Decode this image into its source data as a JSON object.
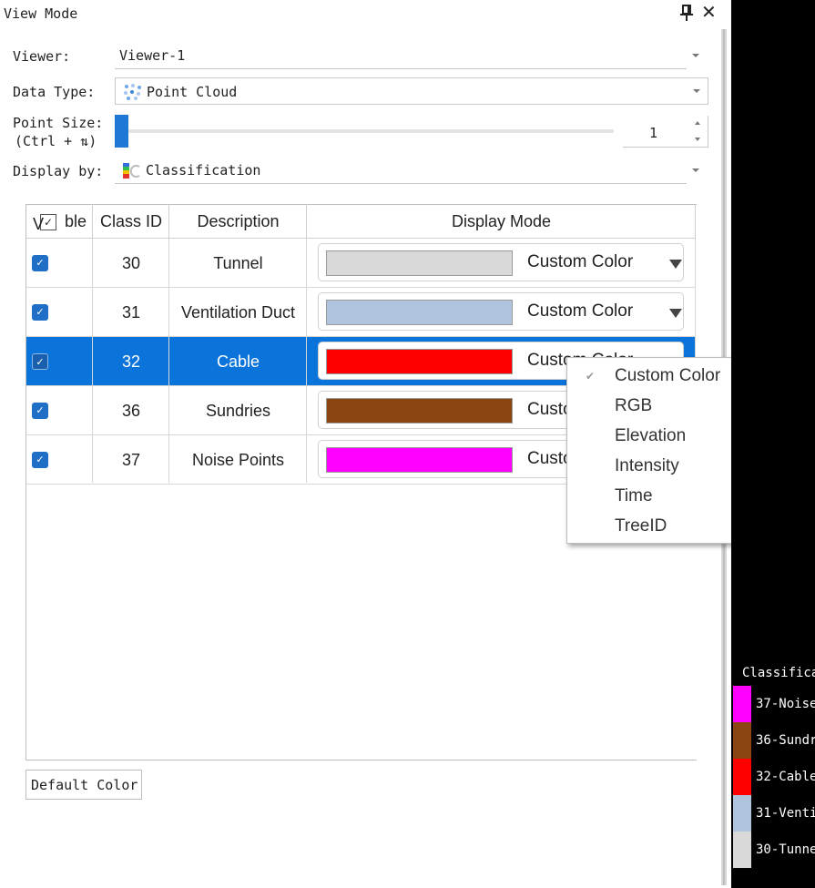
{
  "panel": {
    "title": "View Mode",
    "close_glyph": "✕"
  },
  "props": {
    "viewer_label": "Viewer:",
    "viewer_value": "Viewer-1",
    "data_type_label": "Data Type:",
    "data_type_value": "Point Cloud",
    "point_size_label": "Point Size:",
    "point_size_hint": "(Ctrl + ⇅)",
    "point_size_value": "1",
    "display_by_label": "Display by:",
    "display_by_value": "Classification"
  },
  "table": {
    "headers": {
      "visible": "ble",
      "class_id": "Class ID",
      "description": "Description",
      "display_mode": "Display Mode"
    },
    "rows": [
      {
        "checked": true,
        "class_id": "30",
        "description": "Tunnel",
        "color": "#d9d9d9",
        "mode": "Custom Color",
        "selected": false
      },
      {
        "checked": true,
        "class_id": "31",
        "description": "Ventilation Duct",
        "color": "#b0c4de",
        "mode": "Custom Color",
        "selected": false
      },
      {
        "checked": true,
        "class_id": "32",
        "description": "Cable",
        "color": "#ff0000",
        "mode": "Custom Color",
        "selected": true
      },
      {
        "checked": true,
        "class_id": "36",
        "description": "Sundries",
        "color": "#8b4513",
        "mode": "Custom Color",
        "selected": false
      },
      {
        "checked": true,
        "class_id": "37",
        "description": "Noise Points",
        "color": "#ff00ff",
        "mode": "Custom Color",
        "selected": false
      }
    ]
  },
  "buttons": {
    "default_color": "Default Color"
  },
  "menu": {
    "items": [
      {
        "label": "Custom Color",
        "checked": true,
        "submenu": false
      },
      {
        "label": "RGB",
        "checked": false,
        "submenu": false
      },
      {
        "label": "Elevation",
        "checked": false,
        "submenu": true
      },
      {
        "label": "Intensity",
        "checked": false,
        "submenu": true
      },
      {
        "label": "Time",
        "checked": false,
        "submenu": true
      },
      {
        "label": "TreeID",
        "checked": false,
        "submenu": false
      }
    ]
  },
  "legend": {
    "title": "Classifica",
    "items": [
      {
        "label": "37-Noise",
        "color": "#ff00ff"
      },
      {
        "label": "36-Sundr",
        "color": "#8b4513"
      },
      {
        "label": "32-Cable",
        "color": "#ff0000"
      },
      {
        "label": "31-Venti",
        "color": "#b0c4de"
      },
      {
        "label": "30-Tunne",
        "color": "#d9d9d9"
      }
    ]
  },
  "icons": {
    "pin": "pin-icon",
    "close": "close-icon",
    "point_cloud": "point-cloud-icon",
    "classification": "classification-icon"
  }
}
